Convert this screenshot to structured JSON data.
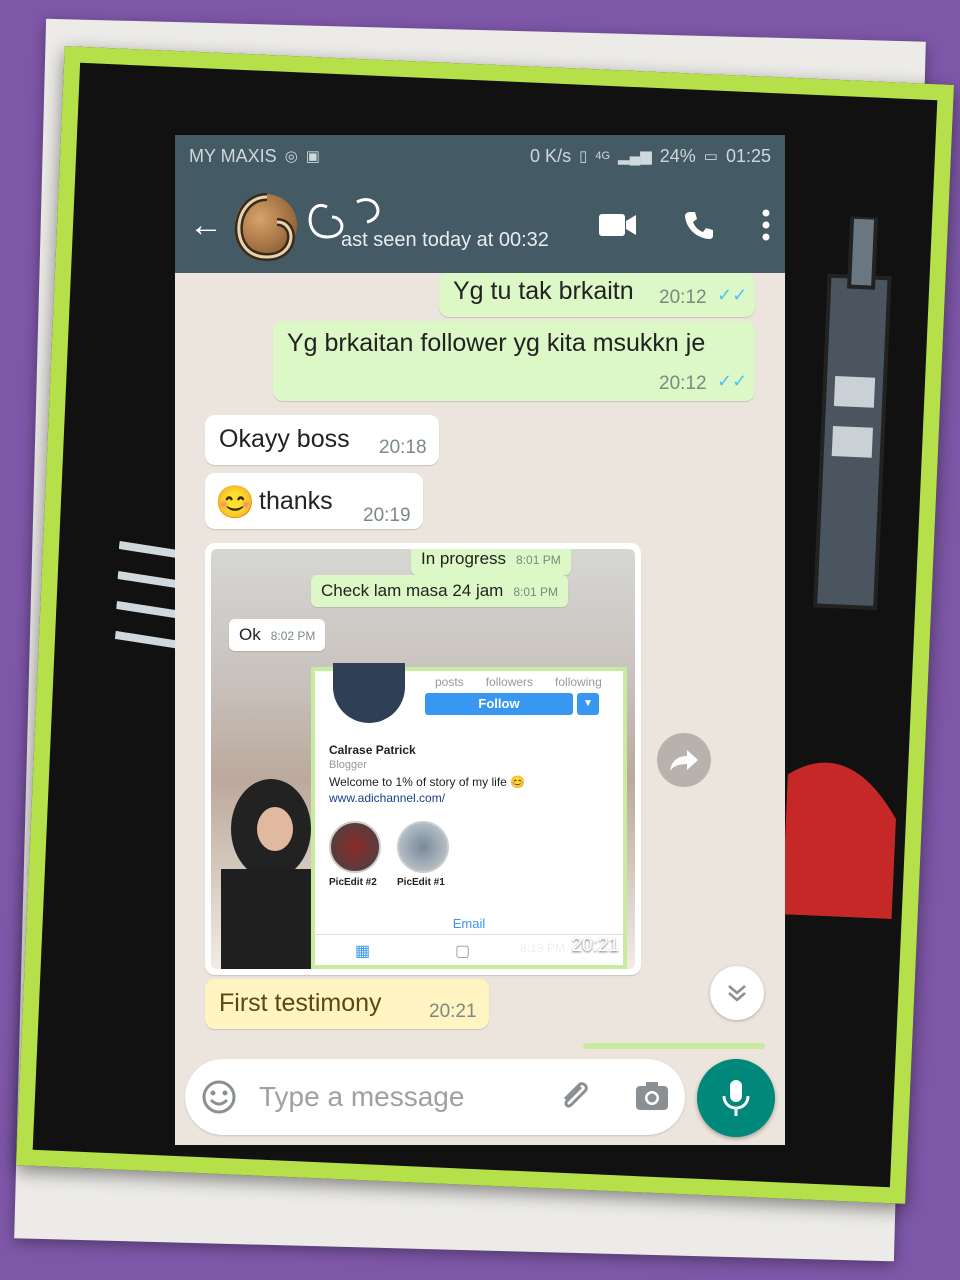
{
  "status_bar": {
    "carrier": "MY MAXIS",
    "speed": "0 K/s",
    "network": "4G",
    "battery": "24%",
    "time": "01:25"
  },
  "header": {
    "last_seen": "ast seen today at 00:32"
  },
  "messages": [
    {
      "text": "Yg tu tak brkaitn",
      "time": "20:12",
      "direction": "out"
    },
    {
      "text": "Yg brkaitan follower yg kita msukkn je",
      "time": "20:12",
      "direction": "out"
    },
    {
      "text": "Okayy boss",
      "time": "20:18",
      "direction": "in"
    },
    {
      "text": "thanks",
      "emoji": "😊",
      "time": "20:19",
      "direction": "in"
    },
    {
      "text": "First  testimony",
      "time": "20:21",
      "direction": "in"
    }
  ],
  "media": {
    "time": "20:21",
    "inner_time": "8:19 PM",
    "inner_messages": [
      {
        "text": "In progress",
        "time": "8:01 PM"
      },
      {
        "text": "Check lam masa 24 jam",
        "time": "8:01 PM"
      },
      {
        "text": "Ok",
        "time": "8:02 PM"
      }
    ],
    "profile": {
      "stats": [
        "posts",
        "followers",
        "following"
      ],
      "follow_label": "Follow",
      "name": "Calrase Patrick",
      "role": "Blogger",
      "bio": "Welcome to 1% of story of my life 😊",
      "link": "www.adichannel.com/",
      "highlights": [
        "PicEdit #2",
        "PicEdit #1"
      ],
      "email_label": "Email"
    }
  },
  "composer": {
    "placeholder": "Type a message"
  },
  "colors": {
    "header": "#445a64",
    "outgoing_bubble": "#dcf8c6",
    "incoming_bubble": "#ffffff",
    "mic_button": "#00897b",
    "frame": "#b5e04a",
    "background": "#7e57a8"
  },
  "icons": [
    "back-arrow-icon",
    "video-call-icon",
    "phone-icon",
    "more-vert-icon",
    "emoji-icon",
    "attach-icon",
    "camera-icon",
    "mic-icon",
    "share-icon",
    "scroll-down-icon"
  ]
}
